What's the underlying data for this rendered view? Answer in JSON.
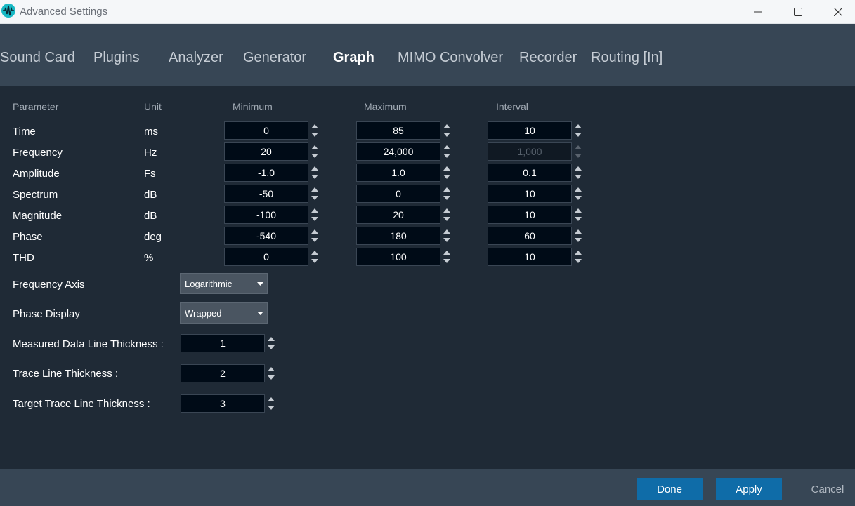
{
  "window": {
    "title": "Advanced Settings"
  },
  "tabs": [
    {
      "label": "Sound Card",
      "active": false
    },
    {
      "label": "Plugins",
      "active": false
    },
    {
      "label": "Analyzer",
      "active": false
    },
    {
      "label": "Generator",
      "active": false
    },
    {
      "label": "Graph",
      "active": true
    },
    {
      "label": "MIMO Convolver",
      "active": false
    },
    {
      "label": "Recorder",
      "active": false
    },
    {
      "label": "Routing [In]",
      "active": false
    }
  ],
  "table": {
    "headers": {
      "parameter": "Parameter",
      "unit": "Unit",
      "minimum": "Minimum",
      "maximum": "Maximum",
      "interval": "Interval"
    },
    "rows": [
      {
        "parameter": "Time",
        "unit": "ms",
        "min": "0",
        "max": "85",
        "interval": "10",
        "interval_disabled": false
      },
      {
        "parameter": "Frequency",
        "unit": "Hz",
        "min": "20",
        "max": "24,000",
        "interval": "1,000",
        "interval_disabled": true
      },
      {
        "parameter": "Amplitude",
        "unit": "Fs",
        "min": "-1.0",
        "max": "1.0",
        "interval": "0.1",
        "interval_disabled": false
      },
      {
        "parameter": "Spectrum",
        "unit": "dB",
        "min": "-50",
        "max": "0",
        "interval": "10",
        "interval_disabled": false
      },
      {
        "parameter": "Magnitude",
        "unit": "dB",
        "min": "-100",
        "max": "20",
        "interval": "10",
        "interval_disabled": false
      },
      {
        "parameter": "Phase",
        "unit": "deg",
        "min": "-540",
        "max": "180",
        "interval": "60",
        "interval_disabled": false
      },
      {
        "parameter": "THD",
        "unit": "%",
        "min": "0",
        "max": "100",
        "interval": "10",
        "interval_disabled": false
      }
    ]
  },
  "options": {
    "frequency_axis": {
      "label": "Frequency Axis",
      "value": "Logarithmic"
    },
    "phase_display": {
      "label": "Phase Display",
      "value": "Wrapped"
    },
    "measured_line_thickness": {
      "label": "Measured Data Line Thickness :",
      "value": "1"
    },
    "trace_line_thickness": {
      "label": "Trace Line Thickness :",
      "value": "2"
    },
    "target_trace_line_thickness": {
      "label": "Target Trace Line Thickness :",
      "value": "3"
    }
  },
  "footer": {
    "done_label": "Done",
    "apply_label": "Apply",
    "cancel_label": "Cancel"
  },
  "colors": {
    "accent": "#1687c8",
    "primary_button": "#0f6ca8",
    "background": "#1f2a36",
    "header_bar": "#374655"
  },
  "icons": {
    "app": "waveform-icon",
    "minimize": "minimize-icon",
    "maximize": "maximize-icon",
    "close": "close-icon",
    "spinner": "spinner-arrows-icon",
    "dropdown": "chevron-down-icon"
  }
}
